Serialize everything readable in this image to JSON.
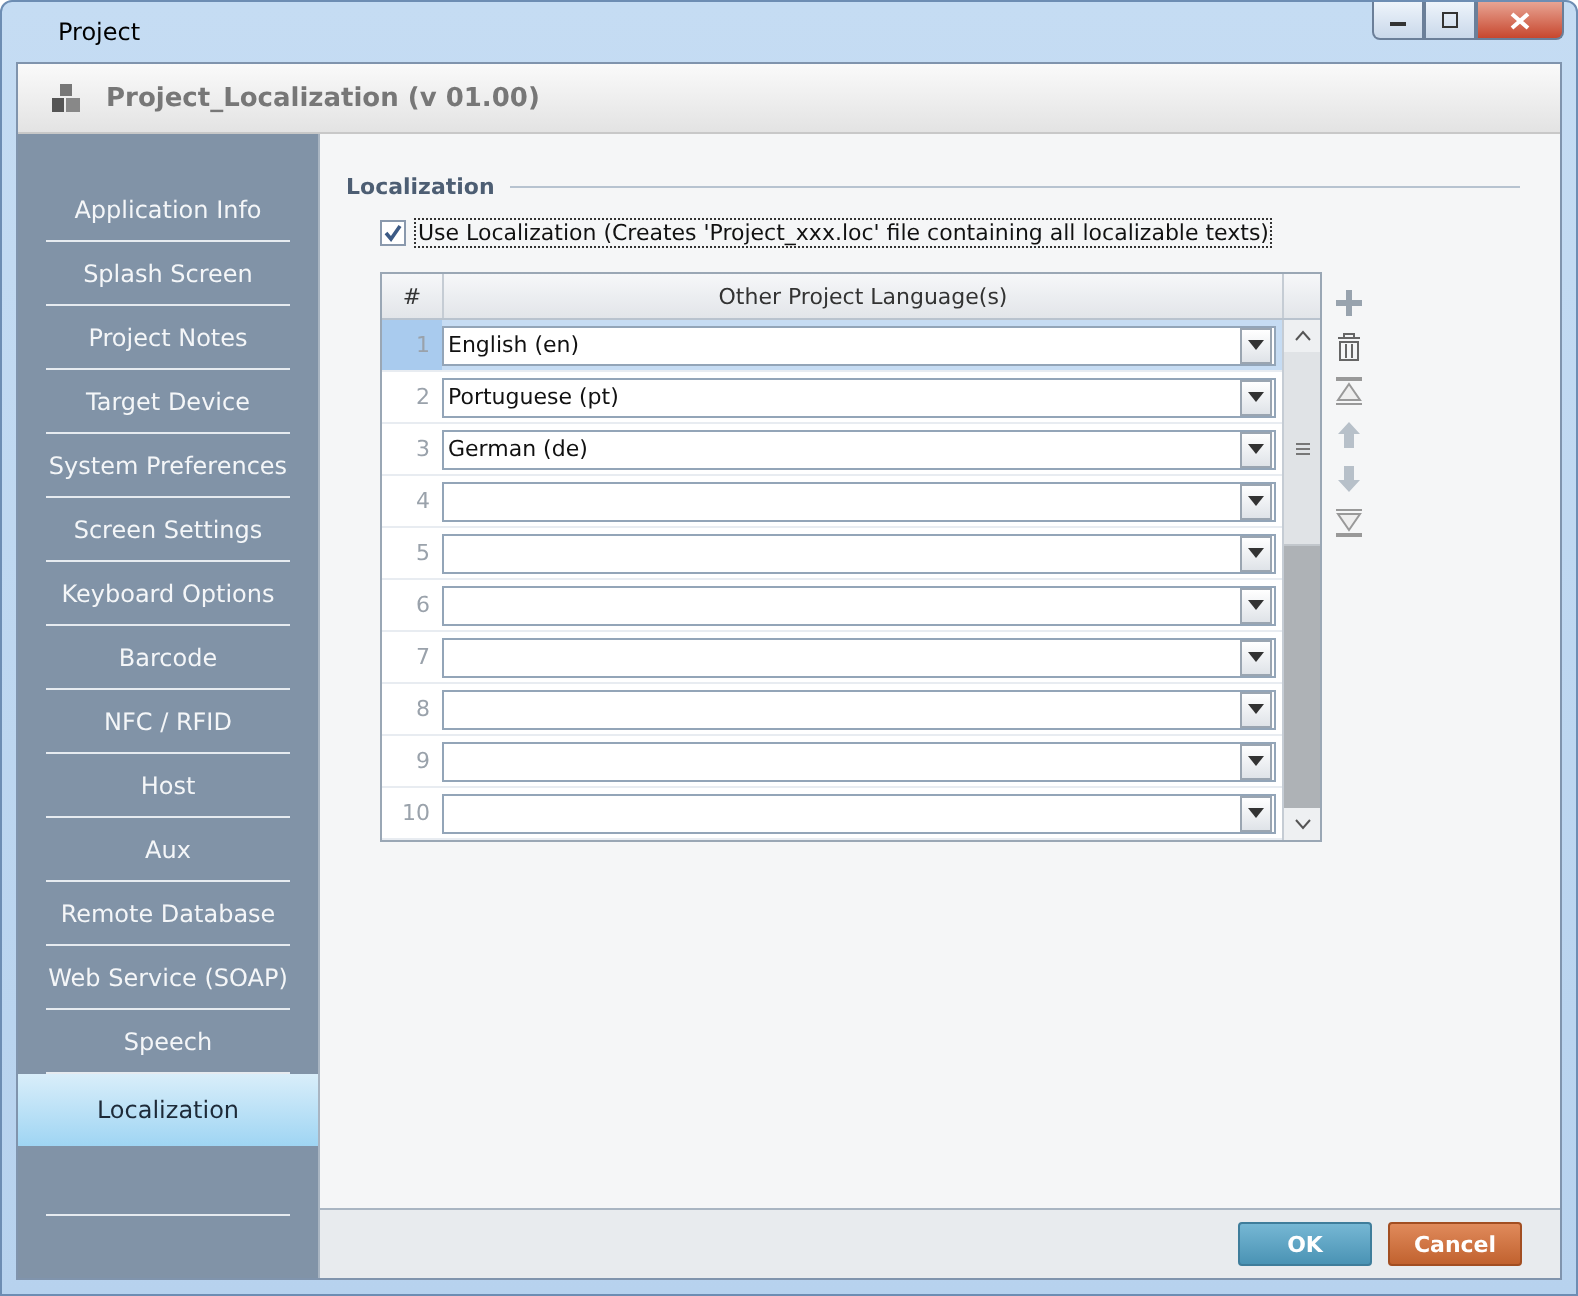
{
  "window": {
    "title": "Project"
  },
  "header": {
    "title": "Project_Localization (v 01.00)"
  },
  "sidebar": {
    "items": [
      {
        "label": "Application Info",
        "selected": false
      },
      {
        "label": "Splash Screen",
        "selected": false
      },
      {
        "label": "Project Notes",
        "selected": false
      },
      {
        "label": "Target Device",
        "selected": false
      },
      {
        "label": "System Preferences",
        "selected": false
      },
      {
        "label": "Screen Settings",
        "selected": false
      },
      {
        "label": "Keyboard Options",
        "selected": false
      },
      {
        "label": "Barcode",
        "selected": false
      },
      {
        "label": "NFC / RFID",
        "selected": false
      },
      {
        "label": "Host",
        "selected": false
      },
      {
        "label": "Aux",
        "selected": false
      },
      {
        "label": "Remote Database",
        "selected": false
      },
      {
        "label": "Web Service (SOAP)",
        "selected": false
      },
      {
        "label": "Speech",
        "selected": false
      },
      {
        "label": "Localization",
        "selected": true
      }
    ]
  },
  "section": {
    "title": "Localization",
    "checkbox": {
      "label": "Use Localization (Creates 'Project_xxx.loc'  file containing all localizable texts)",
      "checked": true
    }
  },
  "table": {
    "columns": [
      "#",
      "Other Project Language(s)"
    ],
    "rows": [
      {
        "number": "1",
        "value": "English  (en)",
        "selected": true
      },
      {
        "number": "2",
        "value": "Portuguese  (pt)",
        "selected": false
      },
      {
        "number": "3",
        "value": "German  (de)",
        "selected": false
      },
      {
        "number": "4",
        "selected": false
      },
      {
        "number": "5",
        "selected": false
      },
      {
        "number": "6",
        "selected": false
      },
      {
        "number": "7",
        "selected": false
      },
      {
        "number": "8",
        "selected": false
      },
      {
        "number": "9",
        "selected": false
      },
      {
        "number": "10",
        "selected": false
      }
    ]
  },
  "buttons": [
    {
      "label": "OK",
      "kind": "primary"
    },
    {
      "label": "Cancel",
      "kind": "danger"
    }
  ]
}
